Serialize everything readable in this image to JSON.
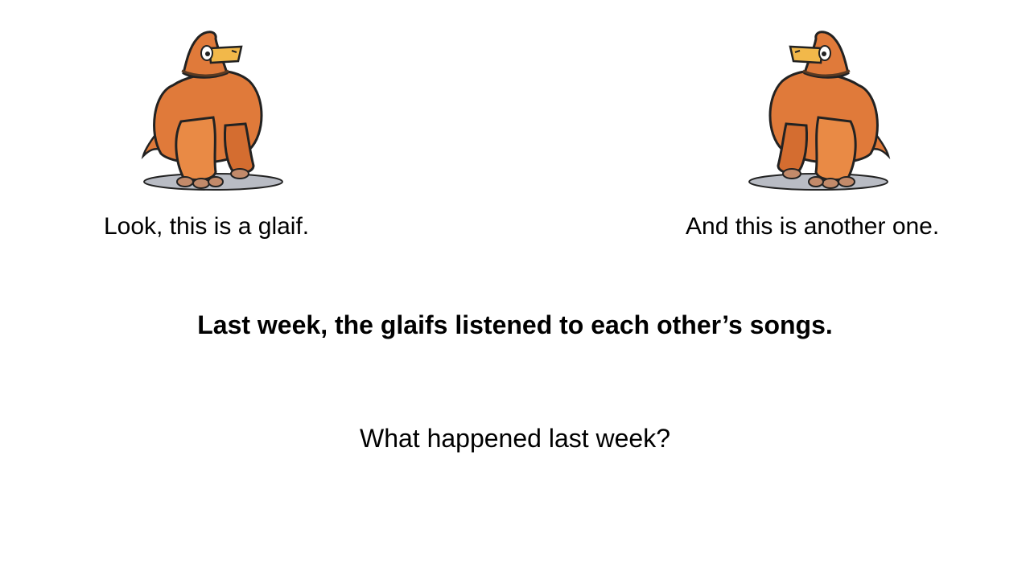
{
  "slide": {
    "caption_left": "Look, this is a glaif.",
    "caption_right": "And this is another one.",
    "statement": "Last week, the glaifs listened to each other’s songs.",
    "question": "What happened last week?"
  },
  "creature": {
    "icon": "glaif-creature-illustration",
    "body_color": "#e07a3a",
    "beak_color": "#f2b84a",
    "shadow_color": "#b9bcc4"
  }
}
